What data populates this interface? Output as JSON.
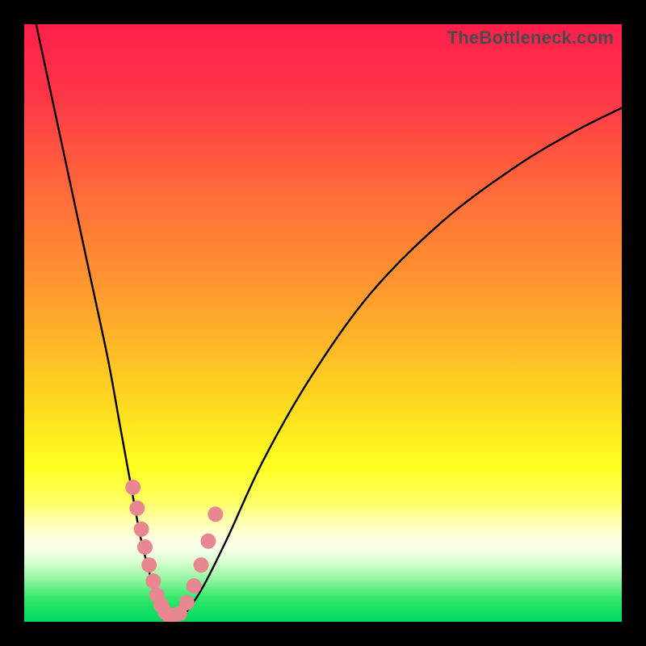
{
  "watermark": "TheBottleneck.com",
  "colors": {
    "frame": "#000000",
    "gradient_stops": [
      {
        "offset": 0.0,
        "color": "#ff1f4a"
      },
      {
        "offset": 0.12,
        "color": "#ff3648"
      },
      {
        "offset": 0.28,
        "color": "#ff6a3a"
      },
      {
        "offset": 0.45,
        "color": "#ff9b2e"
      },
      {
        "offset": 0.62,
        "color": "#ffd421"
      },
      {
        "offset": 0.74,
        "color": "#ffff1f"
      },
      {
        "offset": 0.8,
        "color": "#ffff66"
      },
      {
        "offset": 0.83,
        "color": "#ffffaa"
      },
      {
        "offset": 0.86,
        "color": "#ffffe0"
      },
      {
        "offset": 0.88,
        "color": "#f4ffe8"
      },
      {
        "offset": 0.9,
        "color": "#d8ffd0"
      },
      {
        "offset": 0.93,
        "color": "#90f5a0"
      },
      {
        "offset": 0.96,
        "color": "#34e86c"
      },
      {
        "offset": 1.0,
        "color": "#00d85e"
      }
    ],
    "curve": "#000000",
    "marker_fill": "#e98790",
    "marker_stroke": "#d06873"
  },
  "chart_data": {
    "type": "line",
    "title": "",
    "xlabel": "",
    "ylabel": "",
    "xlim": [
      0,
      100
    ],
    "ylim": [
      0,
      100
    ],
    "series": [
      {
        "name": "bottleneck-curve",
        "x": [
          2,
          5,
          8,
          11,
          14,
          16,
          18,
          19.5,
          21,
          22,
          23,
          24,
          25,
          27,
          30,
          34,
          40,
          48,
          58,
          70,
          82,
          92,
          100
        ],
        "y": [
          100,
          86,
          72,
          58,
          44,
          33,
          22,
          14,
          8,
          4,
          1.5,
          0.5,
          0.5,
          1.5,
          6,
          14,
          27,
          41,
          55,
          67,
          76,
          82,
          86
        ]
      }
    ],
    "markers": {
      "name": "highlighted-points",
      "x": [
        18.2,
        18.9,
        19.6,
        20.2,
        20.9,
        21.6,
        22.2,
        22.9,
        23.6,
        24.3,
        25.0,
        26.0,
        27.2,
        28.4,
        29.6,
        30.8,
        32.0
      ],
      "y": [
        22.5,
        19.0,
        15.5,
        12.5,
        9.5,
        6.8,
        4.5,
        2.8,
        1.6,
        1.0,
        1.0,
        1.4,
        3.2,
        6.0,
        9.5,
        13.5,
        18.0
      ]
    }
  }
}
